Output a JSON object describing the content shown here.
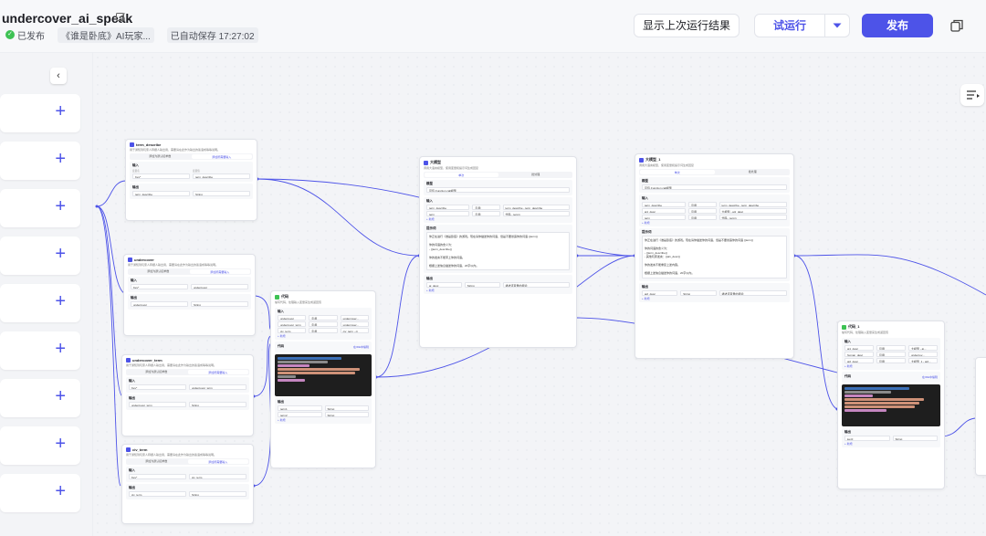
{
  "header": {
    "app_name": "undercover_ai_speak",
    "status": "已发布",
    "bot_tag": "《谁是卧底》AI玩家...",
    "autosave": "已自动保存 17:27:02",
    "show_last_result": "显示上次运行结果",
    "test_run": "试运行",
    "publish": "发布"
  },
  "nodes": {
    "term_describe": {
      "title": "term_describe",
      "desc": "用于通知到玩家人称据人输出用，需要请在此作为输出的答语成等等说明。",
      "tab_a": "添加为默认接参数",
      "tab_b": "添加所需要输入",
      "input_title": "输入",
      "col_name": "变量名",
      "col_value": "变量值",
      "in_key": "Key*",
      "in_val": "term_describe",
      "output_title": "输出",
      "out_name": "term_describe",
      "out_type": "String"
    },
    "undercover": {
      "title": "undercover",
      "desc": "用于通知到玩家人称据人输出用，需要请在此作为输出的答语成等等说明。",
      "tab_a": "添加为默认接参数",
      "tab_b": "添加所需要输入",
      "input_title": "输入",
      "in_key": "Key*",
      "in_val": "undercover",
      "output_title": "输出",
      "out_name": "undercover",
      "out_type": "String"
    },
    "undercover_term": {
      "title": "undercover_term",
      "desc": "用于通知到玩家人称据人输出用，需要请在此作为输出的答语成等等说明。",
      "tab_a": "添加为默认接参数",
      "tab_b": "添加所需要输入",
      "input_title": "输入",
      "in_key": "Key*",
      "in_val": "undercover_term",
      "output_title": "输出",
      "out_name": "undercover_term",
      "out_type": "String"
    },
    "civ_term": {
      "title": "civ_term",
      "desc": "用于通知到玩家人称据人输出用，需要请在此作为输出的答语成等等说明。",
      "tab_a": "添加为默认接参数",
      "tab_b": "添加所需要输入",
      "input_title": "输入",
      "in_key": "Key*",
      "in_val": "civ_term",
      "output_title": "输出",
      "out_name": "civ_term",
      "out_type": "String"
    },
    "code1": {
      "title": "代码",
      "desc": "编写代码，处理输入变量来生成返回值",
      "input_title": "输入",
      "rows": [
        {
          "name": "undercover",
          "ref": "引用",
          "val": "undercover -"
        },
        {
          "name": "undercover_term",
          "ref": "引用",
          "val": "undercover -"
        },
        {
          "name": "civ_term",
          "ref": "引用",
          "val": "civ_term - ci"
        }
      ],
      "add": "+ 新增",
      "code_title": "代码",
      "ide": "在IDE中编辑",
      "output_title": "输出",
      "outputs": [
        {
          "name": "term1",
          "type": "String"
        },
        {
          "name": "term2",
          "type": "String"
        }
      ]
    },
    "llm1": {
      "title": "大模型",
      "desc": "调用大语言模型，使用变量和提示词生成回复",
      "tab_a": "单次",
      "tab_b": "批处理",
      "model_title": "模型",
      "model": "豆包·Function call模型",
      "input_title": "输入",
      "rows": [
        {
          "name": "term_describe",
          "ref": "引用",
          "val": "term_describe - term_describe"
        },
        {
          "name": "term",
          "ref": "引用",
          "val": "代码 - term1"
        }
      ],
      "add": "+ 新增",
      "prompt_title": "提示词",
      "prompt": "你正在进行《谁是卧底》的游戏。现在请你描述你的词语，但是不要暴露你的词语 {{term}}\n\n你的词语的含义为：\n- {{term_describe}}\n\n你的发言不能带上你的词语。\n\n根据上述信息描述你的词语，20字以内。",
      "output_title": "输出",
      "out_name": "ai_desc",
      "out_type": "String",
      "out_ph": "描述该变量的用途"
    },
    "llm2": {
      "title": "大模型_1",
      "desc": "调用大语言模型，使用变量和提示词生成回复",
      "tab_a": "单次",
      "tab_b": "批处理",
      "model_title": "模型",
      "model": "豆包·Function call模型",
      "input_title": "输入",
      "rows": [
        {
          "name": "term_describe",
          "ref": "引用",
          "val": "term_describe - term_describe"
        },
        {
          "name": "ai1_desc",
          "ref": "引用",
          "val": "大模型 - ai1_desc"
        },
        {
          "name": "term",
          "ref": "引用",
          "val": "代码 - term1"
        }
      ],
      "add": "+ 新增",
      "prompt_title": "提示词",
      "prompt": "你正在进行《谁是卧底》的游戏。现在请你描述你的词语，但是不要暴露你的词语 {{term}}\n\n你的词语的含义为：\n- {{term_describe}}\n- 其他玩家发言：{{ai1_desc}}\n\n你的发言不能重复上述内容。\n\n根据上述信息描述你的词语，20字以内。",
      "output_title": "输出",
      "out_name": "ai2_desc",
      "out_type": "String",
      "out_ph": "描述该变量的用途"
    },
    "code2": {
      "title": "代码_1",
      "desc": "编写代码，处理输入变量来生成返回值",
      "input_title": "输入",
      "rows": [
        {
          "name": "ai1_desc",
          "ref": "引用",
          "val": "大模型 - ai..."
        },
        {
          "name": "human_desc",
          "ref": "引用",
          "val": "undercov..."
        },
        {
          "name": "ai2_desc",
          "ref": "引用",
          "val": "大模型_1 - ai2..."
        }
      ],
      "add": "+ 新增",
      "code_title": "代码",
      "ide": "在IDE中编辑",
      "output_title": "输出",
      "outputs": [
        {
          "name": "key0",
          "type": "String"
        }
      ]
    }
  },
  "colors": {
    "accent": "#4d53e8",
    "published": "#3ec254",
    "wire": "#4d53e8"
  },
  "icons": [
    "edit-icon",
    "check-icon",
    "caret-down-icon",
    "copy-icon",
    "chevron-left-icon",
    "plus-icon",
    "list-icon"
  ]
}
